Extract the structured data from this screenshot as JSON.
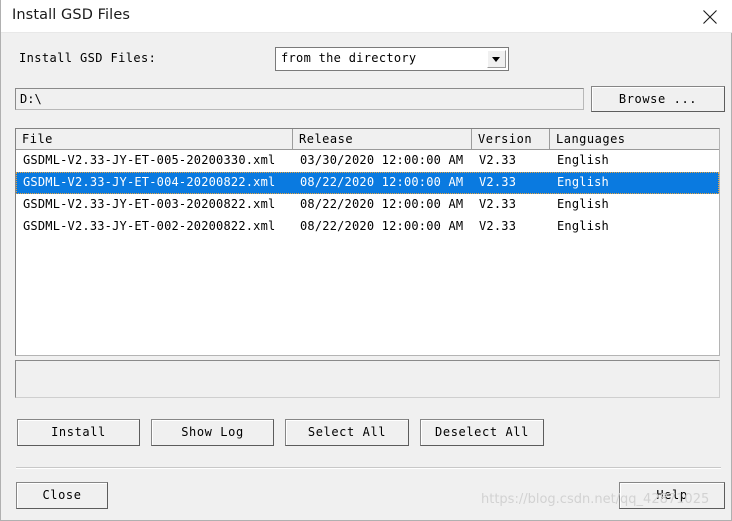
{
  "window": {
    "title": "Install GSD Files",
    "close_icon": "close-icon"
  },
  "form": {
    "install_label": "Install GSD Files:",
    "source_select": {
      "value": "from the directory",
      "options": [
        "from the directory"
      ],
      "arrow_icon": "chevron-down-icon"
    },
    "path_input": {
      "value": "D:\\",
      "placeholder": ""
    },
    "browse_label": "Browse ..."
  },
  "filelist": {
    "columns": [
      "File",
      "Release",
      "Version",
      "Languages"
    ],
    "rows": [
      {
        "file": "GSDML-V2.33-JY-ET-005-20200330.xml",
        "release": "03/30/2020 12:00:00 AM",
        "version": "V2.33",
        "language": "English",
        "selected": false
      },
      {
        "file": "GSDML-V2.33-JY-ET-004-20200822.xml",
        "release": "08/22/2020 12:00:00 AM",
        "version": "V2.33",
        "language": "English",
        "selected": true
      },
      {
        "file": "GSDML-V2.33-JY-ET-003-20200822.xml",
        "release": "08/22/2020 12:00:00 AM",
        "version": "V2.33",
        "language": "English",
        "selected": false
      },
      {
        "file": "GSDML-V2.33-JY-ET-002-20200822.xml",
        "release": "08/22/2020 12:00:00 AM",
        "version": "V2.33",
        "language": "English",
        "selected": false
      }
    ],
    "selection_color": "#0a7ae0"
  },
  "logpanel": {
    "text": ""
  },
  "actions": {
    "install": "Install",
    "show_log": "Show Log",
    "select_all": "Select All",
    "deselect_all": "Deselect All"
  },
  "footer": {
    "close": "Close",
    "help": "Help"
  },
  "watermark": {
    "text": "https://blog.csdn.net/qq_42871025"
  }
}
